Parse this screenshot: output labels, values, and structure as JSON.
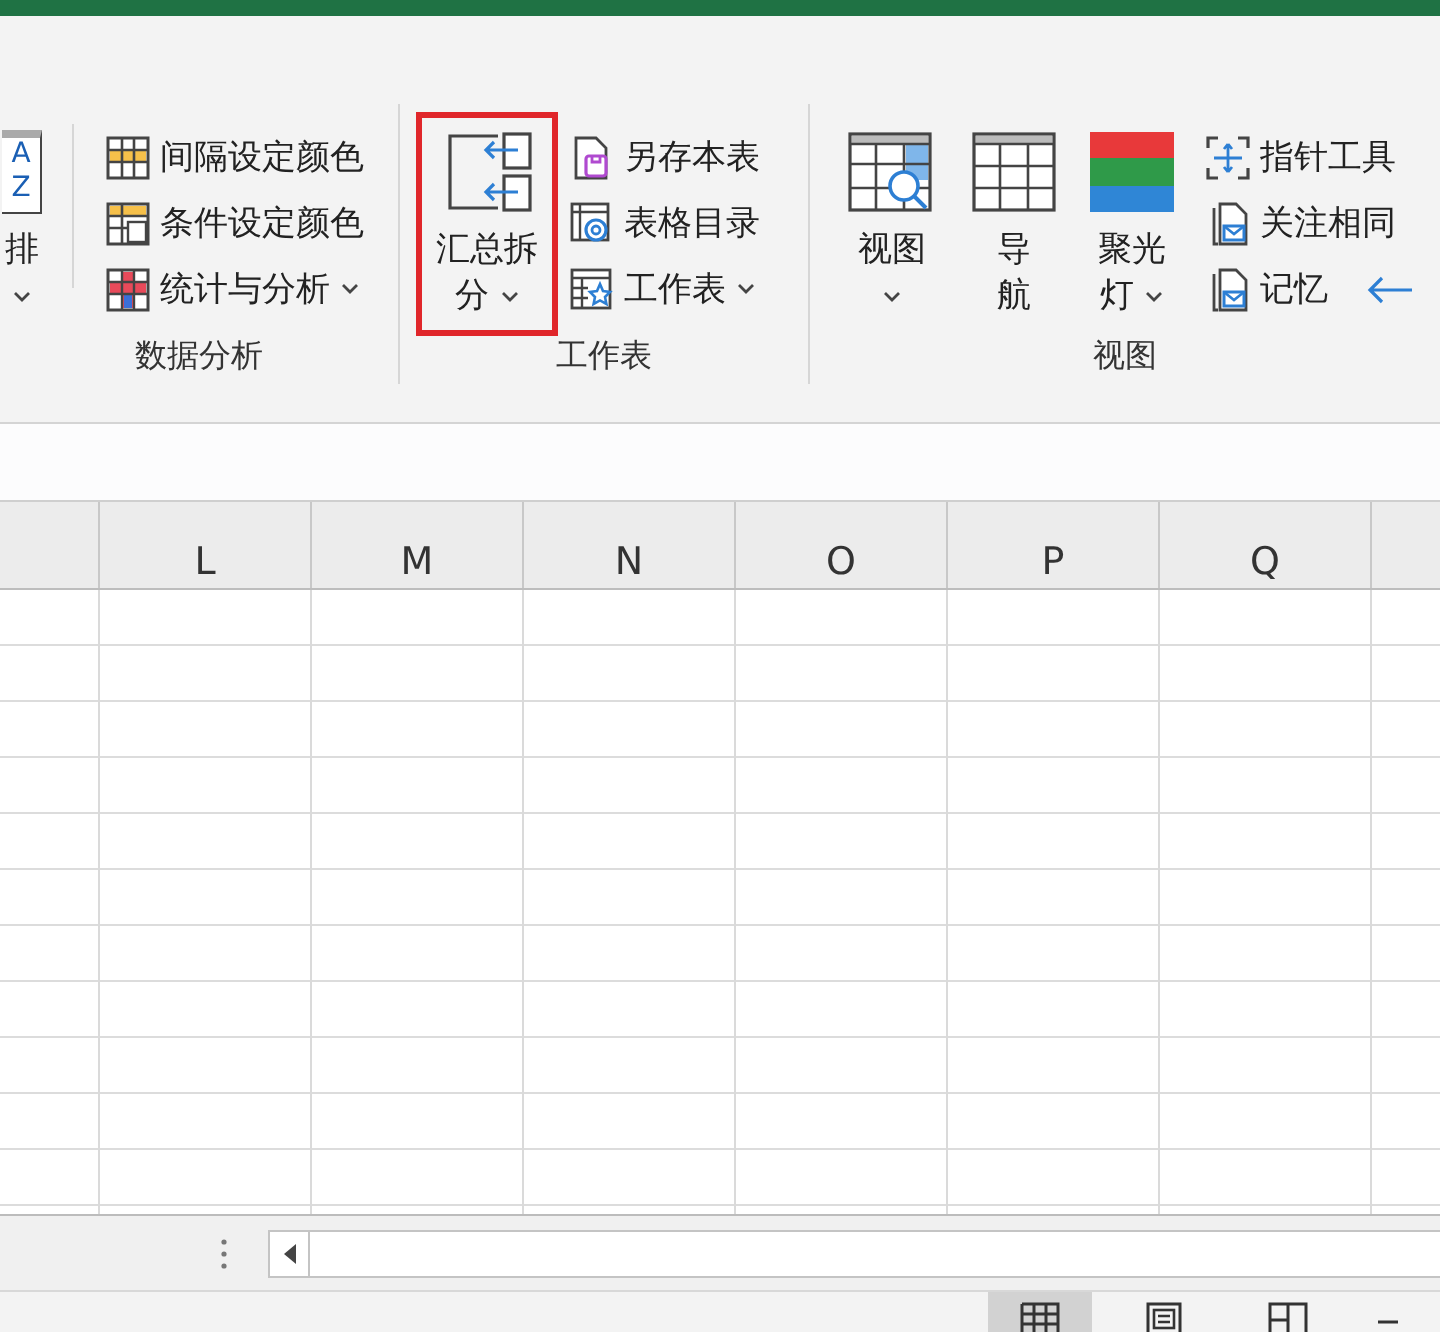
{
  "ribbon": {
    "groups": [
      {
        "label": "数据分析",
        "items": [
          {
            "kind": "large",
            "label_lines": [
              "排"
            ],
            "dropdown": true,
            "icon_text": [
              "A",
              "Z"
            ]
          },
          {
            "kind": "stack",
            "entries": [
              {
                "label": "间隔设定颜色",
                "dropdown": false
              },
              {
                "label": "条件设定颜色",
                "dropdown": false
              },
              {
                "label": "统计与分析",
                "dropdown": true
              }
            ]
          }
        ]
      },
      {
        "label": "工作表",
        "items": [
          {
            "kind": "large",
            "label_lines": [
              "汇总拆",
              "分"
            ],
            "dropdown": true,
            "highlighted": true
          },
          {
            "kind": "stack",
            "entries": [
              {
                "label": "另存本表",
                "dropdown": false
              },
              {
                "label": "表格目录",
                "dropdown": false
              },
              {
                "label": "工作表",
                "dropdown": true
              }
            ]
          }
        ]
      },
      {
        "label": "视图",
        "items": [
          {
            "kind": "large",
            "label_lines": [
              "视图"
            ],
            "dropdown": true
          },
          {
            "kind": "large",
            "label_lines": [
              "导",
              "航"
            ],
            "dropdown": false
          },
          {
            "kind": "large",
            "label_lines": [
              "聚光",
              "灯"
            ],
            "dropdown": true
          },
          {
            "kind": "stack",
            "entries": [
              {
                "label": "指针工具",
                "dropdown": false
              },
              {
                "label": "关注相同",
                "dropdown": false
              },
              {
                "label": "记忆",
                "dropdown": false
              }
            ]
          }
        ]
      }
    ]
  },
  "sheet": {
    "columns": [
      "L",
      "M",
      "N",
      "O",
      "P",
      "Q"
    ]
  },
  "status_bar": {
    "views": [
      {
        "selected": true
      },
      {
        "selected": false
      },
      {
        "selected": false
      }
    ]
  }
}
